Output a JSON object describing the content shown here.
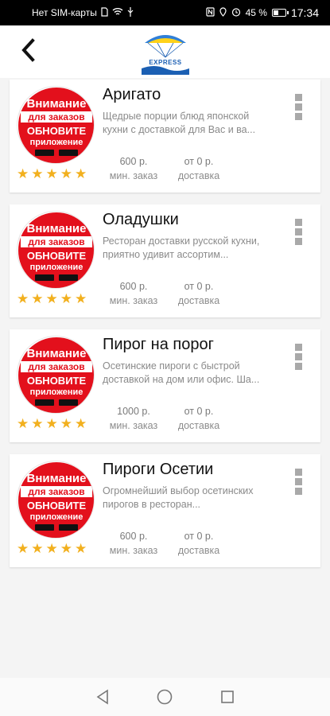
{
  "status": {
    "carrier": "Нет SIM-карты",
    "battery": "45 %",
    "battery_level": 0.45,
    "time": "17:34"
  },
  "header": {
    "back_icon": "chevron-left-icon",
    "logo_text": "EXPRESS"
  },
  "banner": {
    "line1": "Внимание",
    "line2": "для заказов",
    "line3": "ОБНОВИТЕ",
    "line4": "приложение"
  },
  "restaurants": [
    {
      "name": "Аригато",
      "description": "Щедрые порции блюд японской кухни с доставкой для Вас и ва...",
      "min_order": "600 р.",
      "min_order_label": "мин. заказ",
      "delivery": "от 0 р.",
      "delivery_label": "доставка",
      "rating": 5
    },
    {
      "name": "Оладушки",
      "description": "Ресторан доставки русской кухни, приятно удивит ассортим...",
      "min_order": "600 р.",
      "min_order_label": "мин. заказ",
      "delivery": "от 0 р.",
      "delivery_label": "доставка",
      "rating": 5
    },
    {
      "name": "Пирог на порог",
      "description": "Осетинские пироги с быстрой доставкой на дом или офис. Ша...",
      "min_order": "1000 р.",
      "min_order_label": "мин. заказ",
      "delivery": "от 0 р.",
      "delivery_label": "доставка",
      "rating": 5
    },
    {
      "name": "Пироги Осетии",
      "description": "Огромнейший выбор осетинских пирогов в ресторан...",
      "min_order": "600 р.",
      "min_order_label": "мин. заказ",
      "delivery": "от 0 р.",
      "delivery_label": "доставка",
      "rating": 5
    }
  ],
  "colors": {
    "banner_red": "#e3101c",
    "star": "#f2b01e",
    "logo_blue": "#1b5fb3"
  },
  "nav": {
    "back_icon": "triangle-back-icon",
    "home_icon": "circle-home-icon",
    "recents_icon": "square-recents-icon"
  }
}
